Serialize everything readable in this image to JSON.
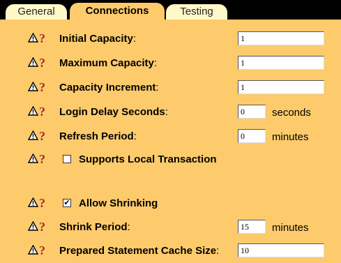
{
  "tabs": [
    {
      "label": "General",
      "active": false
    },
    {
      "label": "Connections",
      "active": true
    },
    {
      "label": "Testing",
      "active": false
    }
  ],
  "fields": {
    "initial_capacity": {
      "label": "Initial Capacity",
      "value": "1"
    },
    "maximum_capacity": {
      "label": "Maximum Capacity",
      "value": "1"
    },
    "capacity_increment": {
      "label": "Capacity Increment",
      "value": "1"
    },
    "login_delay_seconds": {
      "label": "Login Delay Seconds",
      "value": "0",
      "unit": "seconds"
    },
    "refresh_period": {
      "label": "Refresh Period",
      "value": "0",
      "unit": "minutes"
    },
    "supports_local_transaction": {
      "label": "Supports Local Transaction",
      "checked": false
    },
    "allow_shrinking": {
      "label": "Allow Shrinking",
      "checked": true
    },
    "shrink_period": {
      "label": "Shrink Period",
      "value": "15",
      "unit": "minutes"
    },
    "prepared_statement_cache_size": {
      "label": "Prepared Statement Cache Size",
      "value": "10"
    }
  },
  "colon": ":",
  "help_glyph": "?",
  "check_mark": "✔",
  "icons": {
    "warning": "warning-icon",
    "help": "help-icon"
  },
  "colors": {
    "background": "#FDCB6C",
    "inactive_tab": "#FFF9C9",
    "tab_bar": "#000000",
    "help": "#A52A2A"
  }
}
